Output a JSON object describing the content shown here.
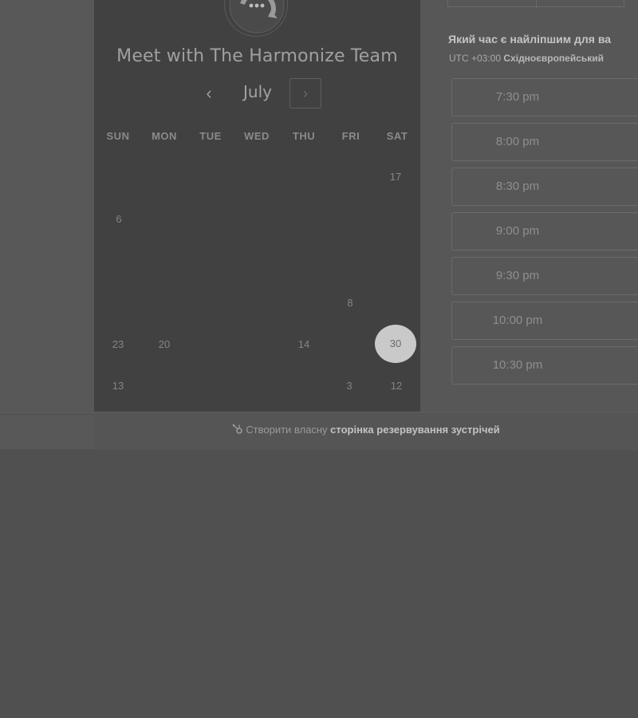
{
  "meeting": {
    "title": "Meet with The Harmonize Team",
    "avatar_icon": "chat-bubble-icon"
  },
  "calendar": {
    "month": "July",
    "prev_icon": "chevron-left-icon",
    "next_icon": "chevron-right-icon",
    "weekdays": [
      "SUN",
      "MON",
      "TUE",
      "WED",
      "THU",
      "FRI",
      "SAT"
    ],
    "visible_days": [
      "17",
      "6",
      "8",
      "23",
      "20",
      "14",
      "13",
      "3",
      "12"
    ],
    "selected_day": "30"
  },
  "booking": {
    "question": "Який час є найліпшим для ва",
    "tz_offset": "UTC +03:00",
    "tz_name": "Східноєвропейський",
    "slots": [
      "7:30 pm",
      "8:00 pm",
      "8:30 pm",
      "9:00 pm",
      "9:30 pm",
      "10:00 pm",
      "10:30 pm"
    ]
  },
  "footer": {
    "prefix": "Створити власну",
    "link": "сторінка резервування зустрічей",
    "icon": "hubspot-sprocket-icon"
  },
  "colors": {
    "page_bg": "#505050",
    "calendar_bg": "#414141",
    "selected_day_bg": "#c9c9c9"
  }
}
